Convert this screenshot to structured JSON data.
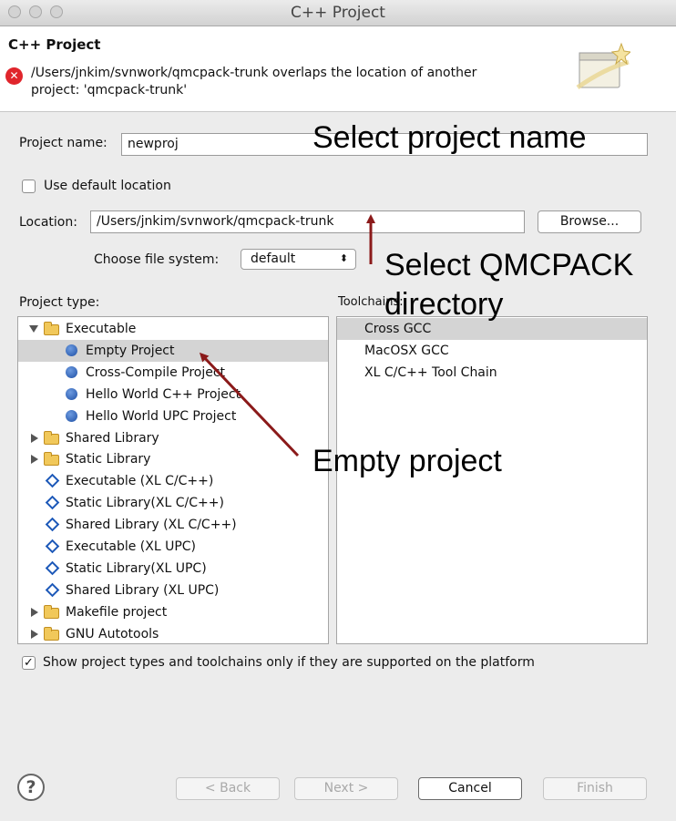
{
  "window": {
    "title": "C++ Project",
    "traffic_lights": [
      "close",
      "minimize",
      "zoom"
    ]
  },
  "header": {
    "title": "C++ Project",
    "error_icon": "error-x-icon",
    "error_line1": "/Users/jnkim/svnwork/qmcpack-trunk overlaps the location of another",
    "error_line2": "project: 'qmcpack-trunk'",
    "wizard_icon": "wizard-window-sparkle-icon"
  },
  "form": {
    "project_name_label": "Project name:",
    "project_name_value": "newproj",
    "use_default_location_label": "Use default location",
    "use_default_location_checked": false,
    "location_label": "Location:",
    "location_value": "/Users/jnkim/svnwork/qmcpack-trunk",
    "browse_label": "Browse...",
    "file_system_label": "Choose file system:",
    "file_system_value": "default"
  },
  "project_types": {
    "header": "Project type:",
    "items": [
      {
        "label": "Executable",
        "icon": "folder-icon",
        "expander": "expanded",
        "depth": 0
      },
      {
        "label": "Empty Project",
        "icon": "blue-dot-icon",
        "depth": 1,
        "selected": true
      },
      {
        "label": "Cross-Compile Project",
        "icon": "blue-dot-icon",
        "depth": 1
      },
      {
        "label": "Hello World C++ Project",
        "icon": "blue-dot-icon",
        "depth": 1
      },
      {
        "label": "Hello World UPC Project",
        "icon": "blue-dot-icon",
        "depth": 1
      },
      {
        "label": "Shared Library",
        "icon": "folder-icon",
        "expander": "collapsed",
        "depth": 0
      },
      {
        "label": "Static Library",
        "icon": "folder-icon",
        "expander": "collapsed",
        "depth": 0
      },
      {
        "label": "Executable (XL C/C++)",
        "icon": "diamond-icon",
        "depth": 0
      },
      {
        "label": "Static Library(XL C/C++)",
        "icon": "diamond-icon",
        "depth": 0
      },
      {
        "label": "Shared Library (XL C/C++)",
        "icon": "diamond-icon",
        "depth": 0
      },
      {
        "label": "Executable (XL UPC)",
        "icon": "diamond-icon",
        "depth": 0
      },
      {
        "label": "Static Library(XL UPC)",
        "icon": "diamond-icon",
        "depth": 0
      },
      {
        "label": "Shared Library (XL UPC)",
        "icon": "diamond-icon",
        "depth": 0
      },
      {
        "label": "Makefile project",
        "icon": "folder-icon",
        "expander": "collapsed",
        "depth": 0
      },
      {
        "label": "GNU Autotools",
        "icon": "folder-icon",
        "expander": "collapsed",
        "depth": 0
      }
    ]
  },
  "toolchains": {
    "header": "Toolchains:",
    "items": [
      {
        "label": "Cross GCC",
        "selected": true
      },
      {
        "label": "MacOSX GCC"
      },
      {
        "label": "XL C/C++ Tool Chain"
      }
    ]
  },
  "show_supported_label": "Show project types and toolchains only if they are supported on the platform",
  "show_supported_checked": true,
  "footer": {
    "help_icon": "help-question-icon",
    "back_label": "< Back",
    "next_label": "Next >",
    "cancel_label": "Cancel",
    "finish_label": "Finish"
  },
  "annotations": {
    "project_name": "Select project name",
    "qmcpack_line1": "Select QMCPACK",
    "qmcpack_line2": "directory",
    "empty_project": "Empty project",
    "arrow_color": "#8b1a1a"
  }
}
